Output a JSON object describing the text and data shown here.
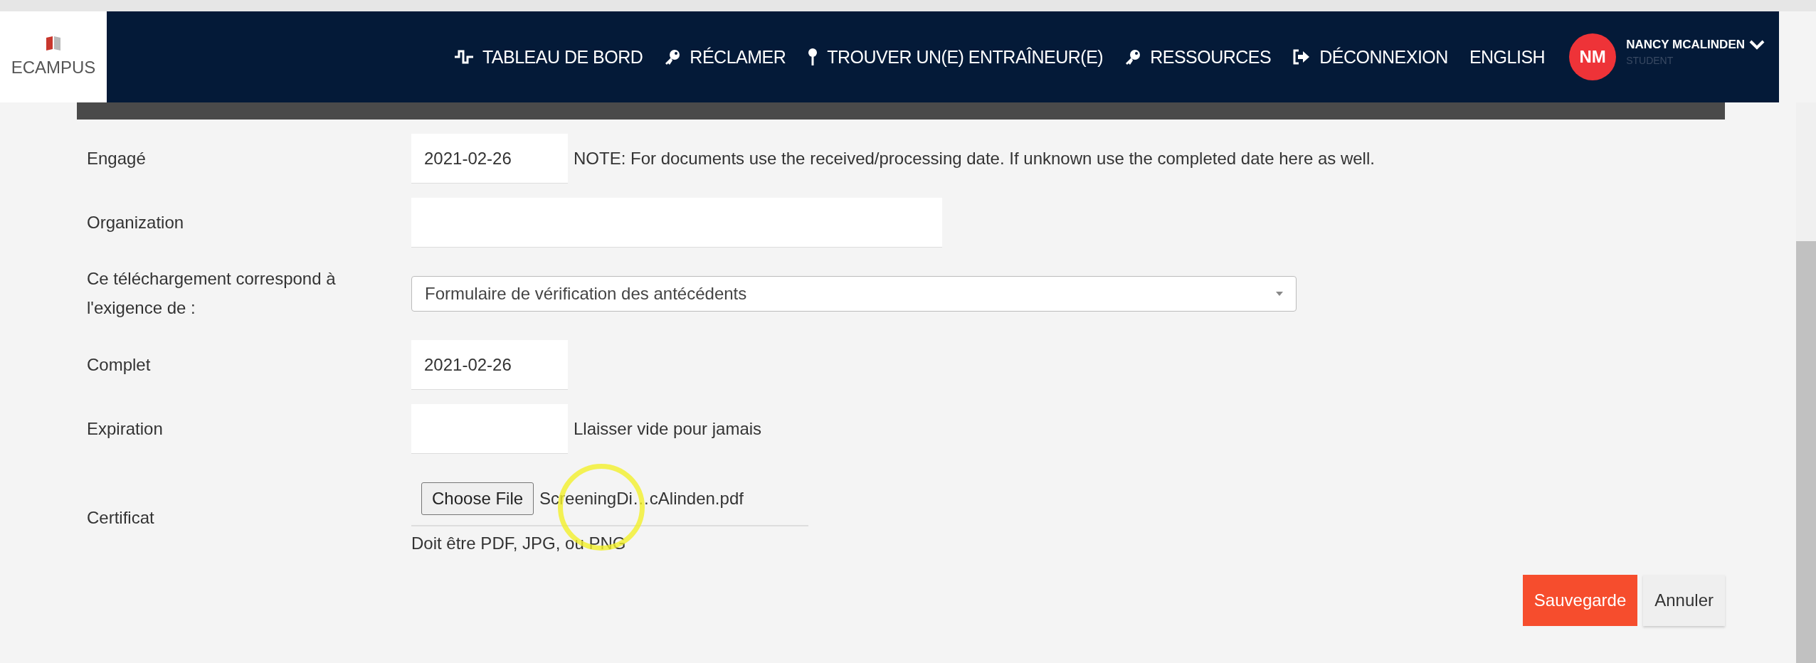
{
  "brand": {
    "name": "ECAMPUS"
  },
  "nav": [
    "TABLEAU DE BORD",
    "RÉCLAMER",
    "TROUVER UN(E) ENTRAÎNEUR(E)",
    "RESSOURCES",
    "DÉCONNEXION",
    "ENGLISH"
  ],
  "user": {
    "initials": "NM",
    "name": "NANCY MCALINDEN",
    "role": "STUDENT"
  },
  "form": [
    {
      "kind": "date",
      "label": "Engagé",
      "value": "2021-02-26",
      "note": "NOTE: For documents use the received/processing date. If unknown use the completed date here as well."
    },
    {
      "kind": "text",
      "label": "Organization"
    },
    {
      "kind": "select",
      "label": "Ce téléchargement correspond à l'exigence de :",
      "value": "Formulaire de vérification des antécédents"
    },
    {
      "kind": "date",
      "label": "Complet",
      "value": "2021-02-26"
    },
    {
      "kind": "date",
      "label": "Expiration",
      "note": "Llaisser vide pour jamais"
    },
    {
      "kind": "file",
      "label": "Certificat",
      "button": "Choose File",
      "value": "ScreeningDi…cAlinden.pdf",
      "hint": "Doit être PDF, JPG, ou PNG"
    }
  ],
  "buttons": {
    "save": "Sauvegarde",
    "cancel": "Annuler"
  }
}
